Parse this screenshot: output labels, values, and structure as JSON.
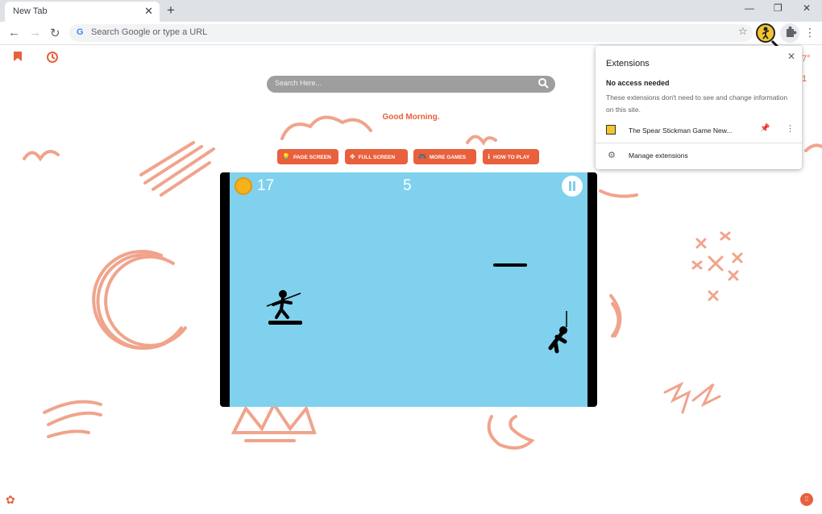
{
  "browser": {
    "tab_title": "New Tab",
    "tab_close": "✕",
    "new_tab": "+",
    "win_min": "—",
    "win_restore": "❐",
    "win_close": "✕",
    "back": "←",
    "forward": "→",
    "reload": "↻",
    "omnibox_placeholder": "Search Google or type a URL",
    "g_logo": "G",
    "star": "☆",
    "menu": "⋮"
  },
  "page": {
    "bookmark_icon": "bookmark-icon",
    "history_icon": "history-icon",
    "weather_partial": "7°",
    "weather_partial2": "1",
    "search_placeholder": "Search Here...",
    "greeting": "Good Morning.",
    "buttons": [
      {
        "label": "PAGE SCREEN",
        "icon": "💡"
      },
      {
        "label": "FULL SCREEN",
        "icon": "✥"
      },
      {
        "label": "MORE GAMES",
        "icon": "🎮"
      },
      {
        "label": "HOW TO PLAY",
        "icon": "ℹ"
      }
    ],
    "settings_icon": "✿",
    "apps_icon": "⁞⁞"
  },
  "game": {
    "coins": "17",
    "score": "5"
  },
  "extensions_popup": {
    "title": "Extensions",
    "close": "✕",
    "section_title": "No access needed",
    "section_desc": "These extensions don't need to see and change information on this site.",
    "extension_name": "The Spear Stickman Game New...",
    "pin": "📌",
    "menu": "⋮",
    "manage_icon": "⚙",
    "manage_label": "Manage extensions"
  },
  "colors": {
    "accent": "#e8603c",
    "game_sky": "#7fd1ed"
  }
}
